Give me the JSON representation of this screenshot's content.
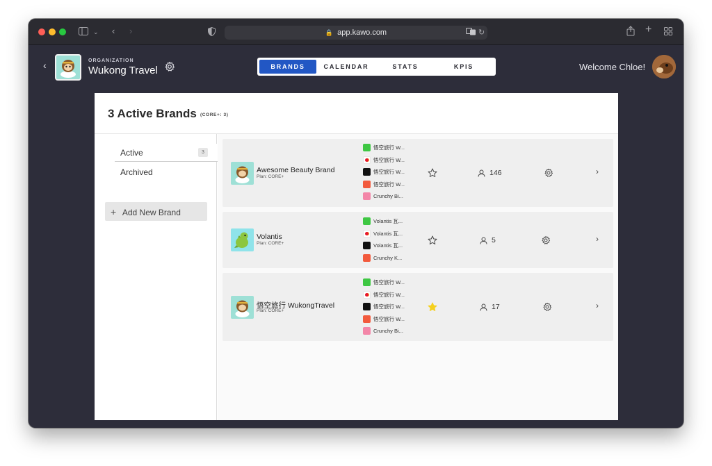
{
  "browser": {
    "url": "app.kawo.com",
    "lock_glyph": "🔒"
  },
  "header": {
    "back_glyph": "‹",
    "org_label": "ORGANIZATION",
    "org_name": "Wukong Travel",
    "tabs": [
      {
        "label": "BRANDS",
        "active": true
      },
      {
        "label": "CALENDAR",
        "active": false
      },
      {
        "label": "STATS",
        "active": false
      },
      {
        "label": "KPIS",
        "active": false
      }
    ],
    "welcome": "Welcome Chloe!"
  },
  "panel": {
    "title": "3 Active Brands",
    "subtitle": "(CORE+: 3)"
  },
  "sidebar": {
    "active_label": "Active",
    "active_count": "3",
    "archived_label": "Archived",
    "add_plus": "+",
    "add_label": "Add New Brand"
  },
  "brands": [
    {
      "name": "Awesome Beauty Brand",
      "plan": "Plan: CORE+",
      "channels": [
        "悟空旅行 W...",
        "悟空旅行 W...",
        "悟空旅行 W...",
        "悟空旅行 W...",
        "Crunchy Bi..."
      ],
      "favorite": false,
      "users": "146",
      "chevron": "›"
    },
    {
      "name": "Volantis",
      "plan": "Plan: CORE+",
      "channels": [
        "Volantis 瓦...",
        "Volantis 瓦...",
        "Volantis 瓦...",
        "Crunchy K..."
      ],
      "favorite": false,
      "users": "5",
      "chevron": "›"
    },
    {
      "name": "悟空旅行 WukongTravel",
      "plan": "Plan: CORE+",
      "channels": [
        "悟空旅行 W...",
        "悟空旅行 W...",
        "悟空旅行 W...",
        "悟空旅行 W...",
        "Crunchy Bi..."
      ],
      "favorite": true,
      "users": "17",
      "chevron": "›"
    }
  ],
  "colors": {
    "accent": "#2257c4",
    "star_active": "#f5d01e",
    "background_dark": "#2d2d3a"
  }
}
